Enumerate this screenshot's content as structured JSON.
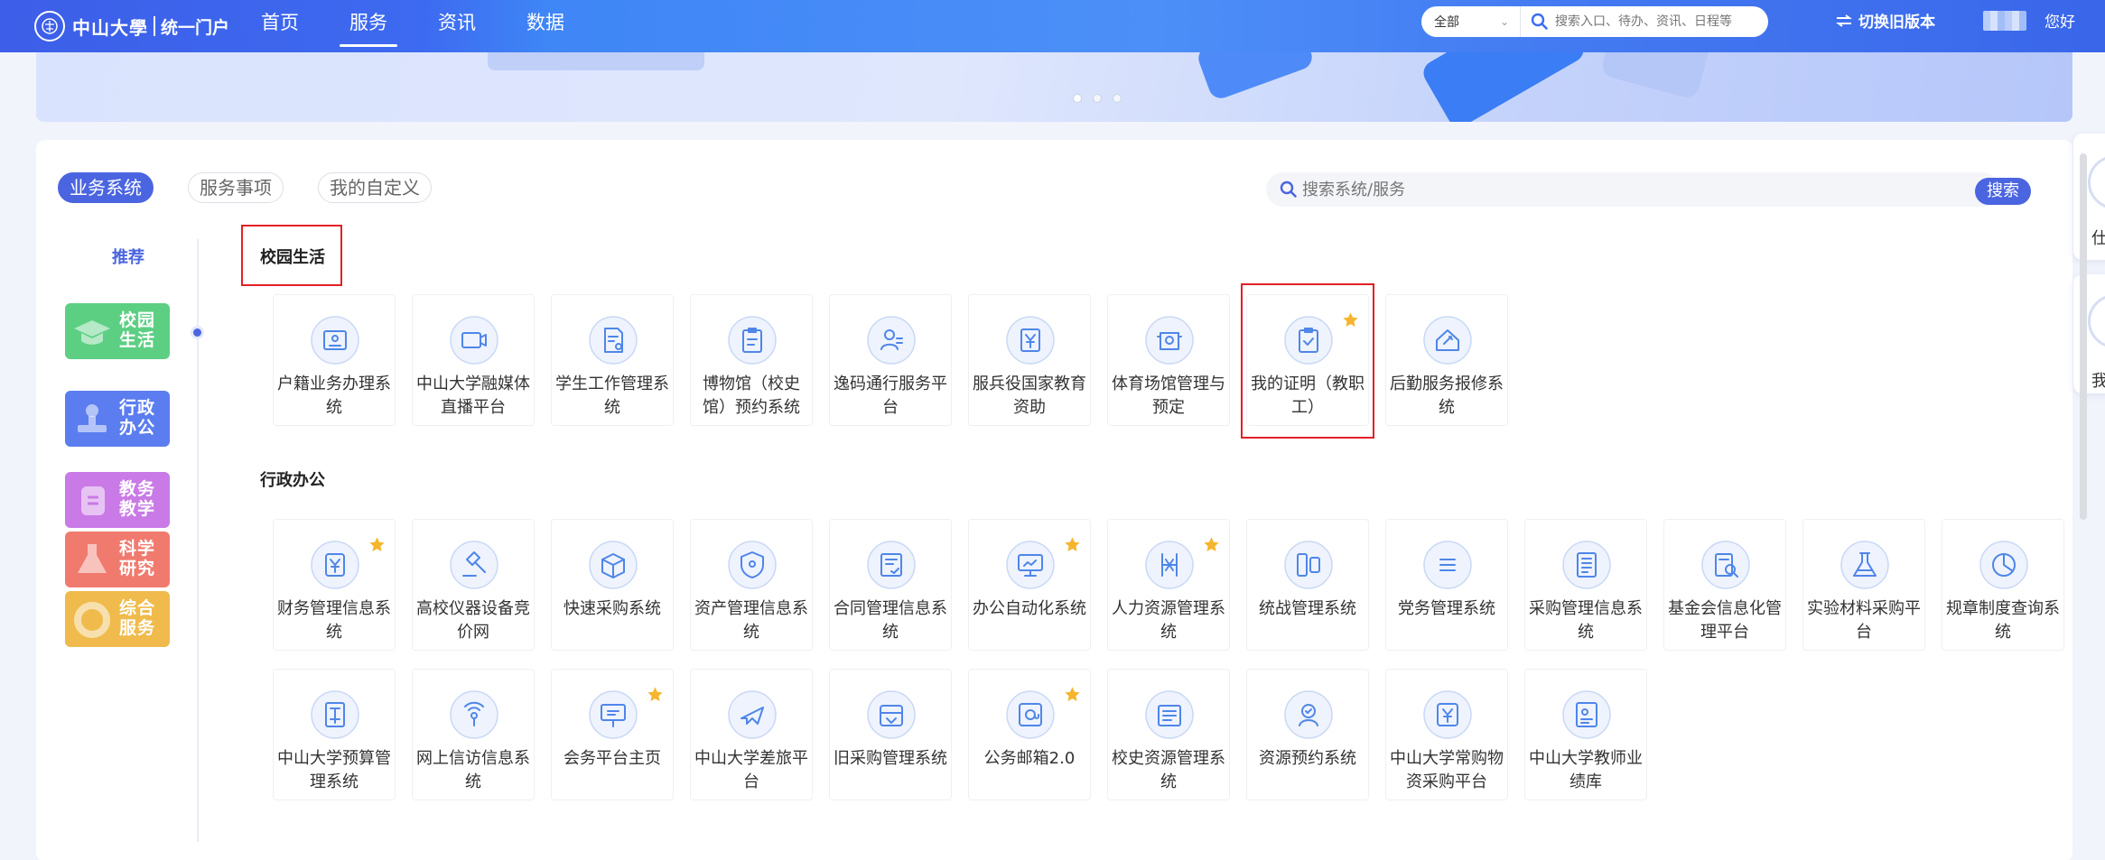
{
  "nav": {
    "logo_name": "中山大學",
    "logo_portal": "统一门户",
    "links": [
      "首页",
      "服务",
      "资讯",
      "数据"
    ],
    "active": "服务"
  },
  "global_search": {
    "scope": "全部",
    "placeholder": "搜索入口、待办、资讯、日程等"
  },
  "switch_old": "切换旧版本",
  "greeting": "您好",
  "tabs": [
    "业务系统",
    "服务事项",
    "我的自定义"
  ],
  "panel_search": {
    "placeholder": "搜索系统/服务",
    "button": "搜索"
  },
  "recommend": "推荐",
  "categories": [
    {
      "label": "校园生活",
      "color": "#5ccf83",
      "icon": "mortarboard-icon"
    },
    {
      "label": "行政办公",
      "color": "#5b7df0",
      "icon": "stamp-icon"
    },
    {
      "label": "教务教学",
      "color": "#c97ae6",
      "icon": "book-icon"
    },
    {
      "label": "科学研究",
      "color": "#f17a6e",
      "icon": "flask-icon"
    },
    {
      "label": "综合服务",
      "color": "#f0bb4c",
      "icon": "lifebuoy-icon"
    }
  ],
  "sections": {
    "campus": {
      "title": "校园生活",
      "items": [
        {
          "label": "户籍业务办理系统",
          "icon": "id-card-icon",
          "star": false
        },
        {
          "label": "中山大学融媒体直播平台",
          "icon": "live-icon",
          "star": false
        },
        {
          "label": "学生工作管理系统",
          "icon": "document-person-icon",
          "star": false
        },
        {
          "label": "博物馆（校史馆）预约系统",
          "icon": "clipboard-icon",
          "star": false
        },
        {
          "label": "逸码通行服务平台",
          "icon": "person-pass-icon",
          "star": false
        },
        {
          "label": "服兵役国家教育资助",
          "icon": "yuan-doc-icon",
          "star": false
        },
        {
          "label": "体育场馆管理与预定",
          "icon": "venue-icon",
          "star": false
        },
        {
          "label": "我的证明（教职工）",
          "icon": "certificate-icon",
          "star": true
        },
        {
          "label": "后勤服务报修系统",
          "icon": "repair-icon",
          "star": false
        }
      ]
    },
    "admin": {
      "title": "行政办公",
      "items": [
        {
          "label": "财务管理信息系统",
          "icon": "yuan-icon",
          "star": true
        },
        {
          "label": "高校仪器设备竞价网",
          "icon": "gavel-icon",
          "star": false
        },
        {
          "label": "快速采购系统",
          "icon": "box-icon",
          "star": false
        },
        {
          "label": "资产管理信息系统",
          "icon": "shield-icon",
          "star": false
        },
        {
          "label": "合同管理信息系统",
          "icon": "contract-icon",
          "star": false
        },
        {
          "label": "办公自动化系统",
          "icon": "monitor-icon",
          "star": true
        },
        {
          "label": "人力资源管理系统",
          "icon": "hr-icon",
          "star": true
        },
        {
          "label": "统战管理系统",
          "icon": "panels-icon",
          "star": false
        },
        {
          "label": "党务管理系统",
          "icon": "party-icon",
          "star": false
        },
        {
          "label": "采购管理信息系统",
          "icon": "list-doc-icon",
          "star": false
        },
        {
          "label": "基金会信息化管理平台",
          "icon": "search-doc-icon",
          "star": false
        },
        {
          "label": "实验材料采购平台",
          "icon": "beaker-icon",
          "star": false
        },
        {
          "label": "规章制度查询系统",
          "icon": "pie-icon",
          "star": false
        },
        {
          "label": "中山大学预算管理系统",
          "icon": "budget-icon",
          "star": false
        },
        {
          "label": "网上信访信息系统",
          "icon": "signal-icon",
          "star": false
        },
        {
          "label": "会务平台主页",
          "icon": "presentation-icon",
          "star": true
        },
        {
          "label": "中山大学差旅平台",
          "icon": "plane-icon",
          "star": false
        },
        {
          "label": "旧采购管理系统",
          "icon": "tray-icon",
          "star": false
        },
        {
          "label": "公务邮箱2.0",
          "icon": "mail-icon",
          "star": true
        },
        {
          "label": "校史资源管理系统",
          "icon": "archive-icon",
          "star": false
        },
        {
          "label": "资源预约系统",
          "icon": "user-check-icon",
          "star": false
        },
        {
          "label": "中山大学常购物资采购平台",
          "icon": "yuan-tag-icon",
          "star": false
        },
        {
          "label": "中山大学教师业绩库",
          "icon": "profile-doc-icon",
          "star": false
        }
      ]
    }
  },
  "right_float": [
    {
      "char": "仕"
    },
    {
      "char": "我"
    }
  ],
  "colors": {
    "accent": "#4b65e0",
    "highlight": "#e32026",
    "star": "#f5b52c",
    "icon": "#4f86e8"
  }
}
